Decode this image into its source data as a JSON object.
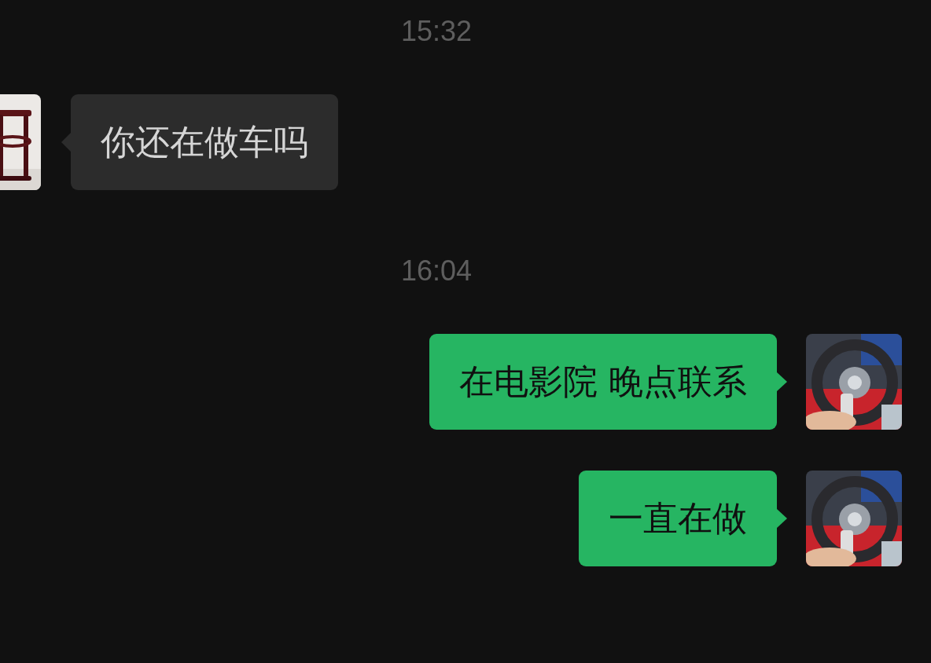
{
  "messages": [
    {
      "kind": "time",
      "text": "15:32"
    },
    {
      "kind": "message",
      "outgoing": false,
      "text": "你还在做车吗"
    },
    {
      "kind": "time",
      "text": "16:04"
    },
    {
      "kind": "message",
      "outgoing": true,
      "text": "在电影院 晚点联系"
    },
    {
      "kind": "message",
      "outgoing": true,
      "text": "一直在做"
    }
  ]
}
